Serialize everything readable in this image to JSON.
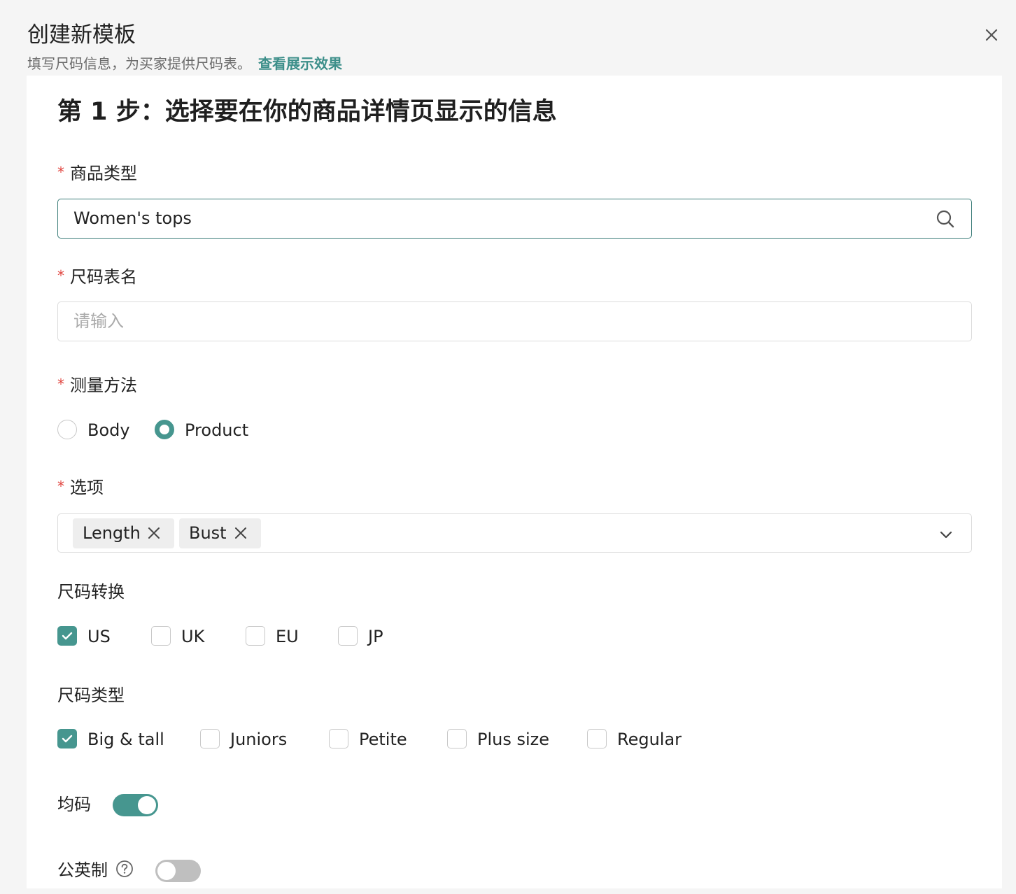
{
  "header": {
    "title": "创建新模板",
    "subtitle": "填写尺码信息，为买家提供尺码表。",
    "preview_link": "查看展示效果"
  },
  "step": {
    "title": "第 1 步：选择要在你的商品详情页显示的信息"
  },
  "product_type": {
    "required_mark": "*",
    "label": "商品类型",
    "value": "Women's tops",
    "icon": "search-icon"
  },
  "size_chart_name": {
    "required_mark": "*",
    "label": "尺码表名",
    "value": "",
    "placeholder": "请输入"
  },
  "measurement": {
    "required_mark": "*",
    "label": "测量方法",
    "options": [
      {
        "label": "Body",
        "selected": false
      },
      {
        "label": "Product",
        "selected": true
      }
    ]
  },
  "options_field": {
    "required_mark": "*",
    "label": "选项",
    "tags": [
      "Length",
      "Bust"
    ],
    "icon": "chevron-down-icon"
  },
  "size_conversion": {
    "label": "尺码转换",
    "options": [
      {
        "label": "US",
        "checked": true
      },
      {
        "label": "UK",
        "checked": false
      },
      {
        "label": "EU",
        "checked": false
      },
      {
        "label": "JP",
        "checked": false
      }
    ]
  },
  "size_type": {
    "label": "尺码类型",
    "options": [
      {
        "label": "Big & tall",
        "checked": true
      },
      {
        "label": "Juniors",
        "checked": false
      },
      {
        "label": "Petite",
        "checked": false
      },
      {
        "label": "Plus size",
        "checked": false
      },
      {
        "label": "Regular",
        "checked": false
      }
    ]
  },
  "one_size": {
    "label": "均码",
    "enabled": true
  },
  "metric": {
    "label": "公英制",
    "enabled": false,
    "icon": "help-circle-icon"
  },
  "colors": {
    "accent": "#46968f",
    "link": "#3d8f8a",
    "required": "#e0443e",
    "toggle_off": "#bfbfbf",
    "page_bg": "#f5f5f5"
  }
}
